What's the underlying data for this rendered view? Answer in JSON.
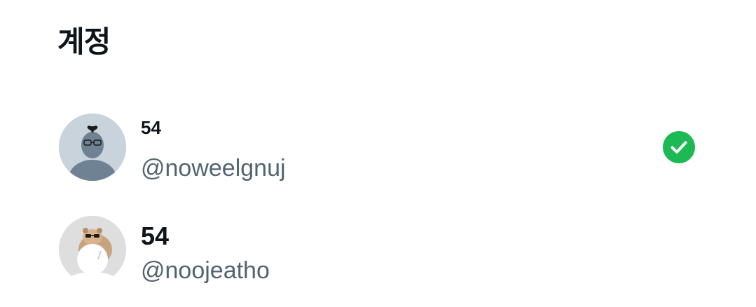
{
  "section": {
    "title": "계정"
  },
  "accounts": [
    {
      "display_name": "54",
      "handle": "@noweelgnuj",
      "selected": true,
      "avatar_icon": "default-avatar-with-glasses-icon",
      "check_icon": "check-circle-icon"
    },
    {
      "display_name": "54",
      "handle": "@noojeatho",
      "selected": false,
      "avatar_icon": "hamster-sunglasses-avatar-icon"
    }
  ],
  "colors": {
    "text_primary": "#0f1419",
    "text_secondary": "#536471",
    "check_green": "#1db954",
    "avatar_bg_1": "#c9d3dc",
    "avatar_figure_1": "#6e8294"
  }
}
